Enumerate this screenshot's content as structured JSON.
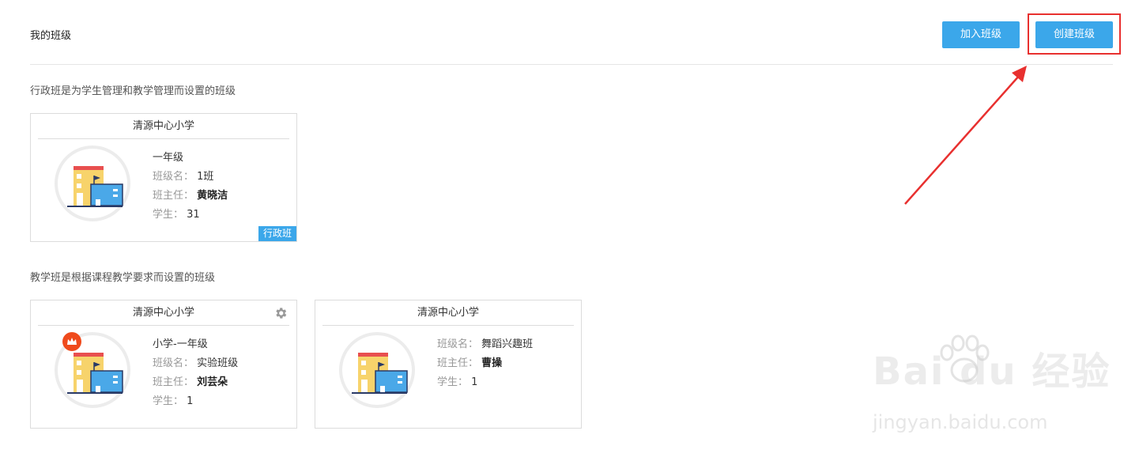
{
  "header": {
    "title": "我的班级",
    "join_button": "加入班级",
    "create_button": "创建班级"
  },
  "admin_section": {
    "description": "行政班是为学生管理和教学管理而设置的班级",
    "cards": [
      {
        "school": "清源中心小学",
        "grade": "一年级",
        "class_name_label": "班级名：",
        "class_name": "1班",
        "teacher_label": "班主任：",
        "teacher": "黄晓洁",
        "students_label": "学生：",
        "students": "31",
        "tag": "行政班"
      }
    ]
  },
  "teaching_section": {
    "description": "教学班是根据课程教学要求而设置的班级",
    "cards": [
      {
        "school": "清源中心小学",
        "grade": "小学-一年级",
        "class_name_label": "班级名：",
        "class_name": "实验班级",
        "teacher_label": "班主任：",
        "teacher": "刘芸朵",
        "students_label": "学生：",
        "students": "1"
      },
      {
        "school": "清源中心小学",
        "class_name_label": "班级名：",
        "class_name": "舞蹈兴趣班",
        "teacher_label": "班主任：",
        "teacher": "曹操",
        "students_label": "学生：",
        "students": "1"
      }
    ]
  },
  "watermark": {
    "brand": "Bai du 经验",
    "url": "jingyan.baidu.com"
  },
  "colors": {
    "accent": "#3ba7ea",
    "highlight": "#e8302f",
    "crown": "#ef4a1c"
  },
  "icons": [
    "building-icon",
    "gear-icon",
    "crown-icon",
    "arrow-annotation"
  ]
}
